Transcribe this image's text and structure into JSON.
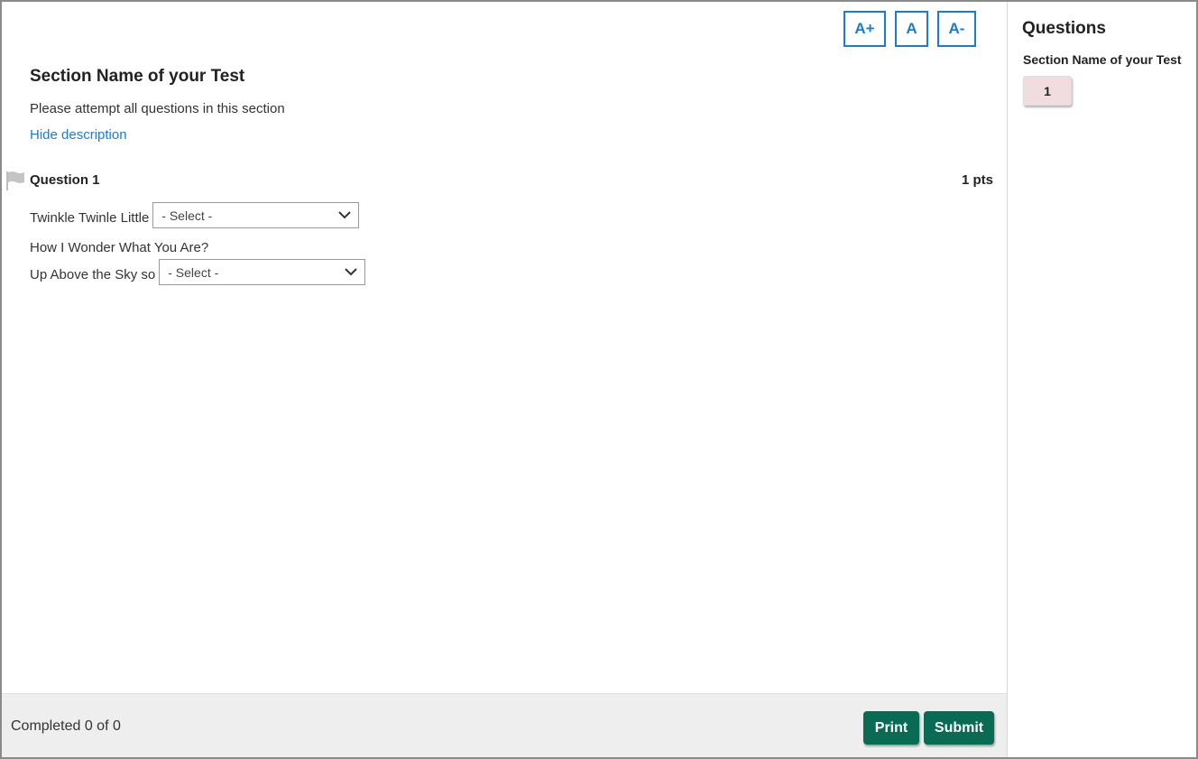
{
  "font_controls": {
    "increase": "A+",
    "reset": "A",
    "decrease": "A-"
  },
  "section": {
    "title": "Section Name of your Test",
    "description": "Please attempt all questions in this section",
    "hide_link": "Hide description"
  },
  "question": {
    "label": "Question 1",
    "points": "1 pts",
    "line1_text": "Twinkle Twinle Little",
    "select1_value": "- Select -",
    "line2_text": "How I Wonder What You Are?",
    "line3_text": "Up Above the Sky so",
    "select2_value": "- Select -"
  },
  "footer": {
    "status": "Completed 0 of 0",
    "print_label": "Print",
    "submit_label": "Submit"
  },
  "sidebar": {
    "title": "Questions",
    "section_name": "Section Name of your Test",
    "question_numbers": [
      "1"
    ]
  },
  "colors": {
    "accent_blue": "#1a7bd6",
    "primary_green": "#0a6b55",
    "chip_pink": "#f1dde0",
    "footer_bg": "#eeeeee"
  },
  "icons": {
    "flag": "flag-icon",
    "dropdown": "chevron-down-icon"
  }
}
